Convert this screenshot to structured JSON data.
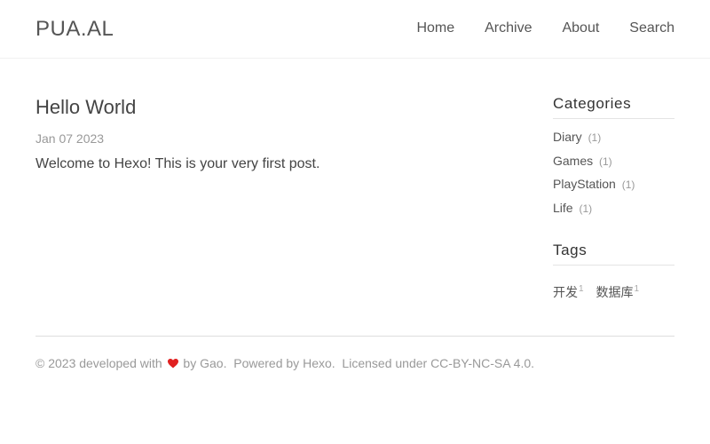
{
  "site": {
    "logo": "PUA.AL",
    "nav": [
      "Home",
      "Archive",
      "About",
      "Search"
    ]
  },
  "post": {
    "title": "Hello World",
    "date": "Jan 07 2023",
    "body": "Welcome to Hexo! This is your very first post."
  },
  "sidebar": {
    "categories_title": "Categories",
    "categories": [
      {
        "name": "Diary",
        "count": "(1)"
      },
      {
        "name": "Games",
        "count": "(1)"
      },
      {
        "name": "PlayStation",
        "count": "(1)"
      },
      {
        "name": "Life",
        "count": "(1)"
      }
    ],
    "tags_title": "Tags",
    "tags": [
      {
        "name": "开发",
        "count": "1"
      },
      {
        "name": "数据库",
        "count": "1"
      }
    ]
  },
  "footer": {
    "prefix": "© 2023 developed with",
    "by": "by",
    "author": "Gao",
    "after_author": ".  Powered by",
    "powered": "Hexo",
    "after_powered": ".  Licensed under",
    "license": "CC-BY-NC-SA 4.0",
    "end": ".",
    "heart_color": "#e02020"
  }
}
